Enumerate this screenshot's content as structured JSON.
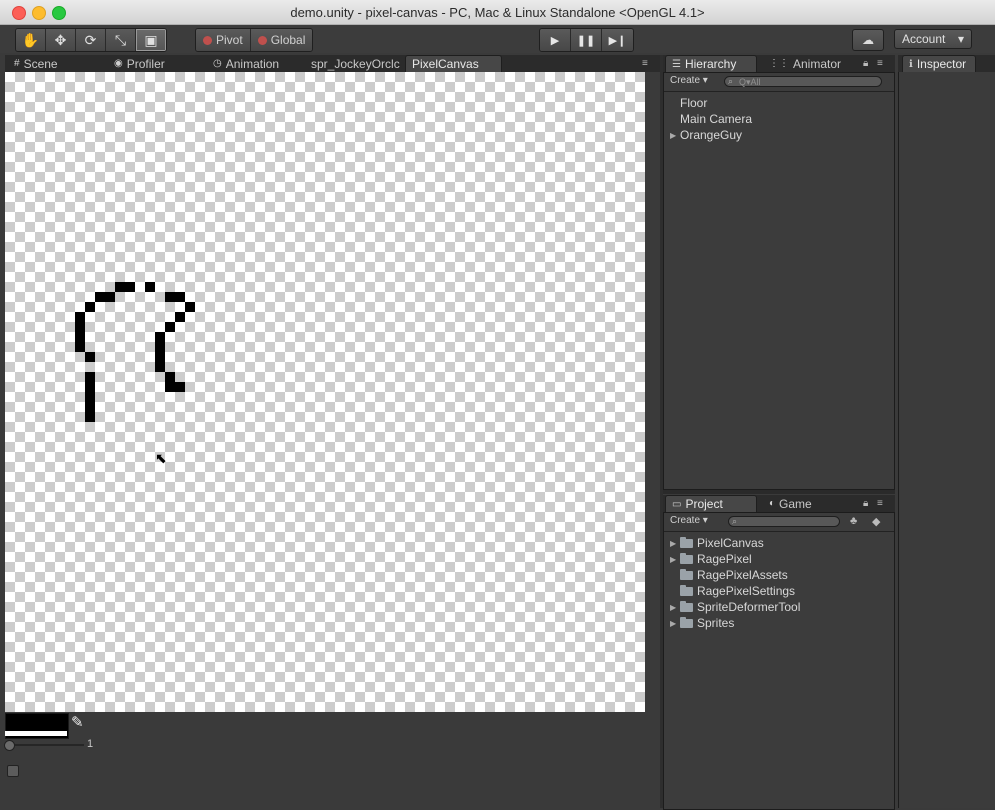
{
  "window": {
    "title": "demo.unity - pixel-canvas - PC, Mac & Linux Standalone <OpenGL 4.1>"
  },
  "toolbar": {
    "tools": [
      "hand-icon",
      "move-icon",
      "rotate-icon",
      "scale-icon",
      "rect-icon"
    ],
    "pivot_label": "Pivot",
    "global_label": "Global",
    "account_label": "Account"
  },
  "tabs_left": [
    {
      "label": "Scene",
      "icon": "scene-icon"
    },
    {
      "label": "Profiler",
      "icon": "profiler-icon"
    },
    {
      "label": "Animation",
      "icon": "animation-icon"
    },
    {
      "label": "spr_JockeyOrclc",
      "icon": ""
    },
    {
      "label": "PixelCanvas",
      "icon": ""
    }
  ],
  "hierarchy": {
    "tab_label": "Hierarchy",
    "animator_label": "Animator",
    "create_label": "Create ▾",
    "search_placeholder": "Q▾All",
    "items": [
      "Floor",
      "Main Camera",
      "OrangeGuy"
    ]
  },
  "inspector": {
    "tab_label": "Inspector"
  },
  "project": {
    "tab_label": "Project",
    "game_label": "Game",
    "create_label": "Create ▾",
    "items": [
      "PixelCanvas",
      "RagePixel",
      "RagePixelAssets",
      "RagePixelSettings",
      "SpriteDeformerTool",
      "Sprites"
    ],
    "expandable": [
      true,
      true,
      false,
      false,
      true,
      true
    ]
  },
  "canvas_tools": {
    "brush_size": "1"
  },
  "colors": {
    "editor_bg": "#3a3a3a",
    "paint_color": "#000000",
    "accent_red": "#fc5f57"
  }
}
